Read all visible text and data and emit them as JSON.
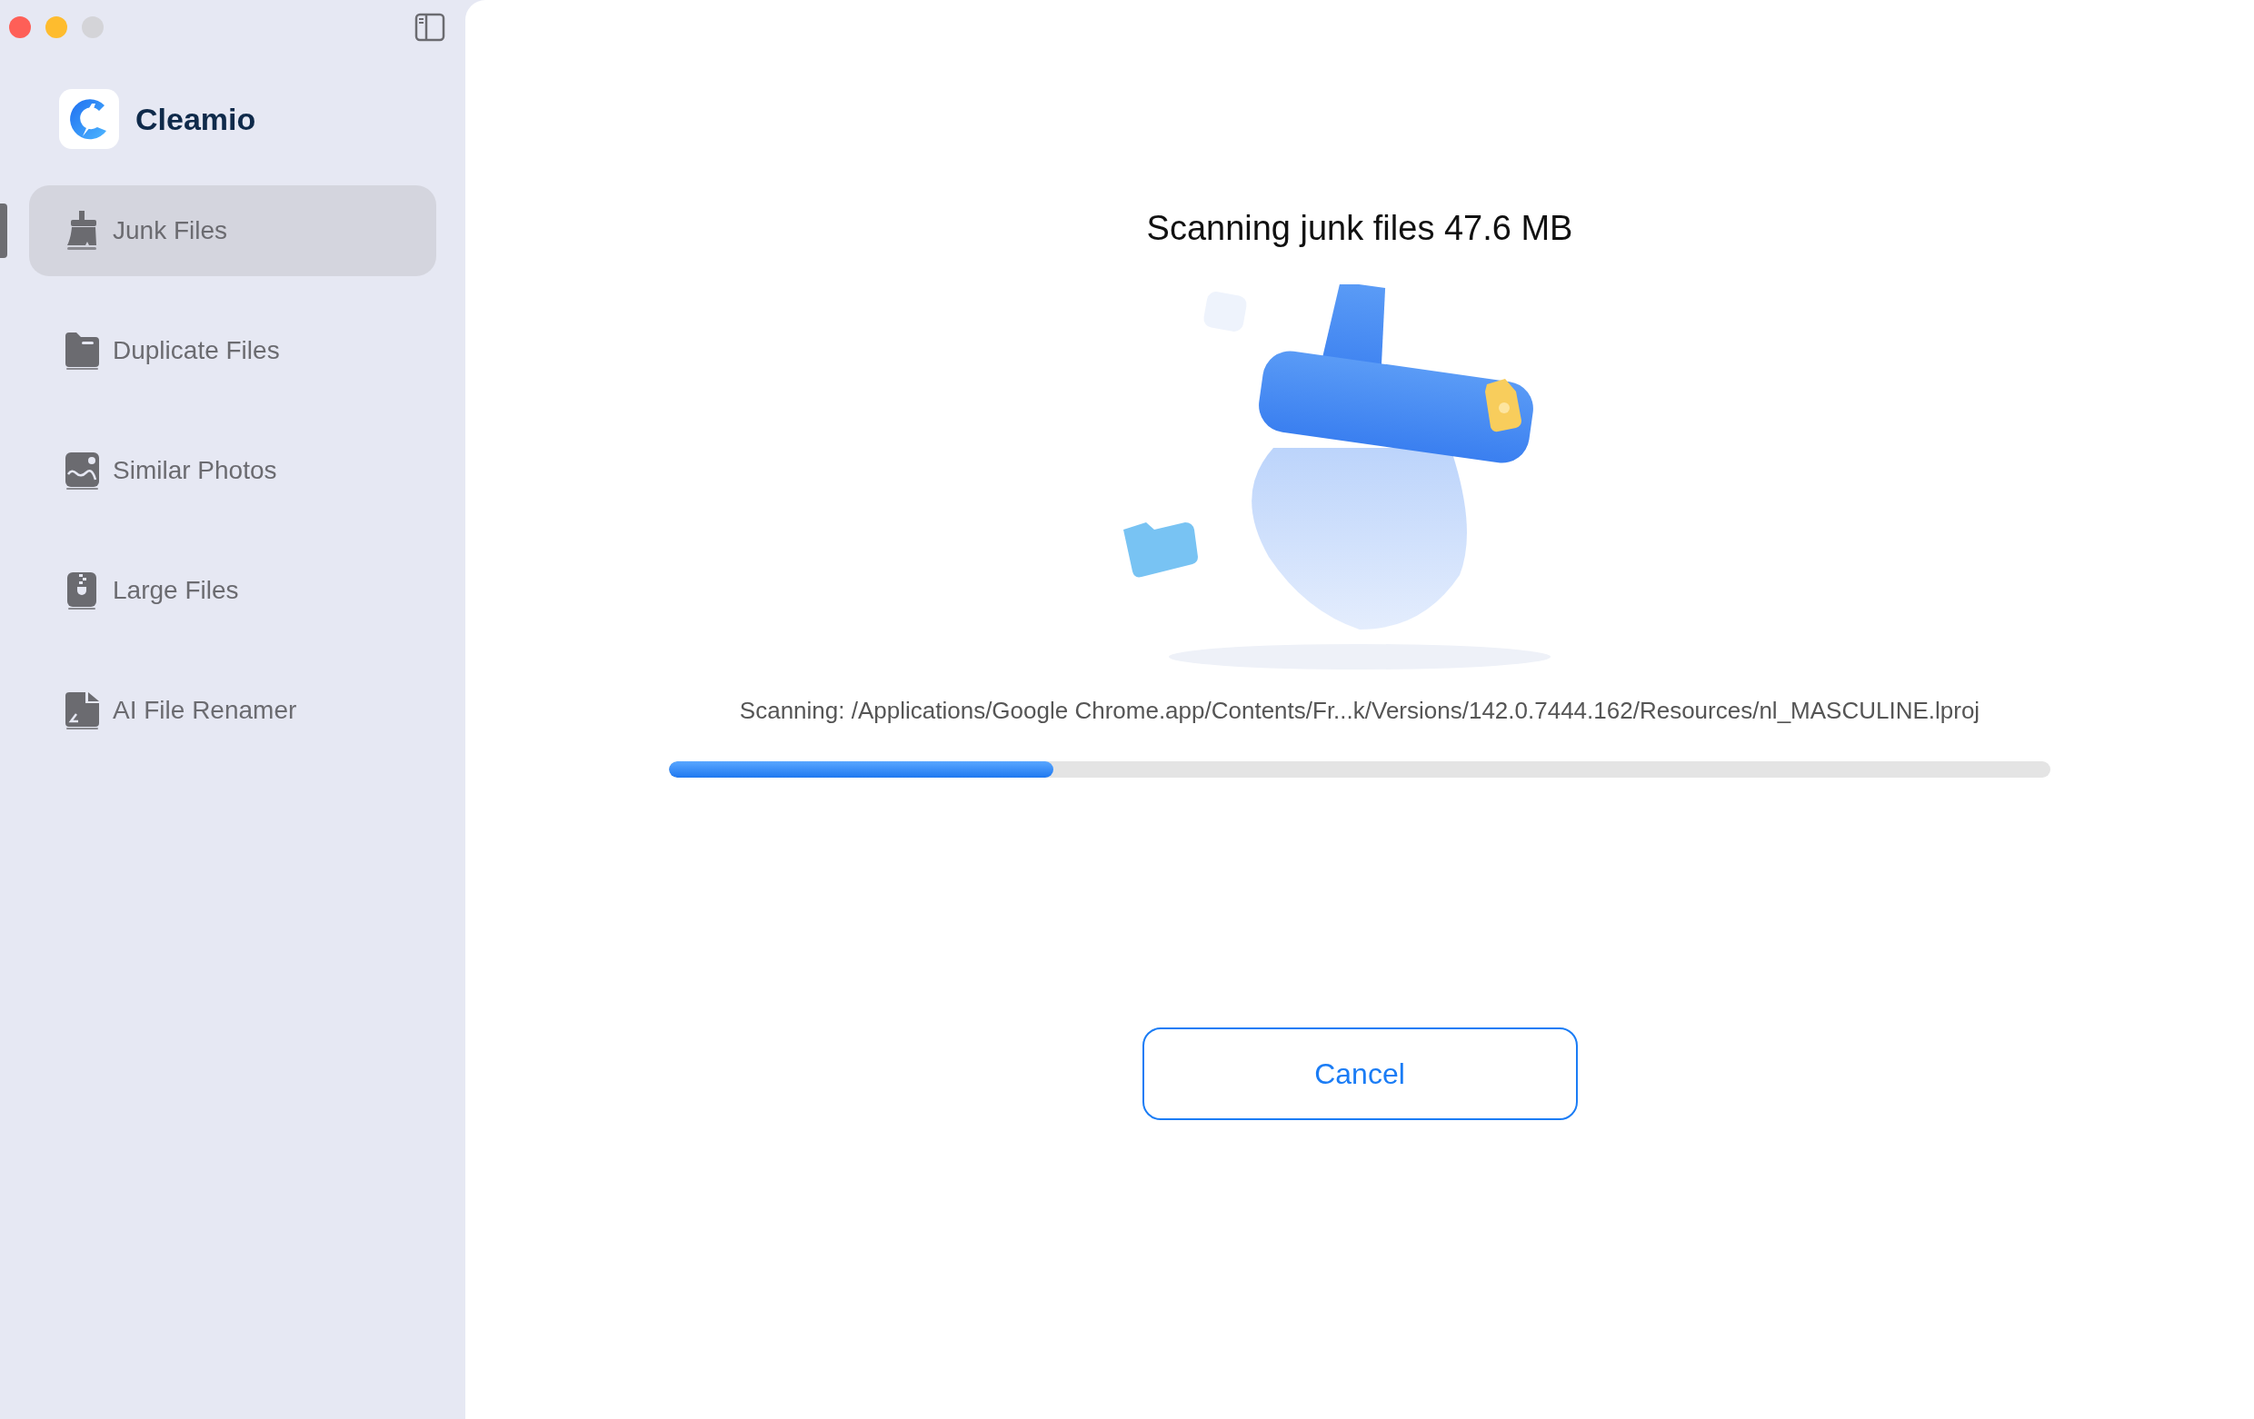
{
  "app": {
    "name": "Cleamio"
  },
  "sidebar": {
    "items": [
      {
        "label": "Junk Files",
        "kind": "broom",
        "selected": true
      },
      {
        "label": "Duplicate Files",
        "kind": "folder",
        "selected": false
      },
      {
        "label": "Similar Photos",
        "kind": "photo",
        "selected": false
      },
      {
        "label": "Large Files",
        "kind": "zip",
        "selected": false
      },
      {
        "label": "AI File Renamer",
        "kind": "rename",
        "selected": false
      }
    ]
  },
  "scan": {
    "title": "Scanning junk files 47.6 MB",
    "path": "Scanning: /Applications/Google Chrome.app/Contents/Fr...k/Versions/142.0.7444.162/Resources/nl_MASCULINE.lproj",
    "level": 0.278,
    "cancel": "Cancel"
  }
}
